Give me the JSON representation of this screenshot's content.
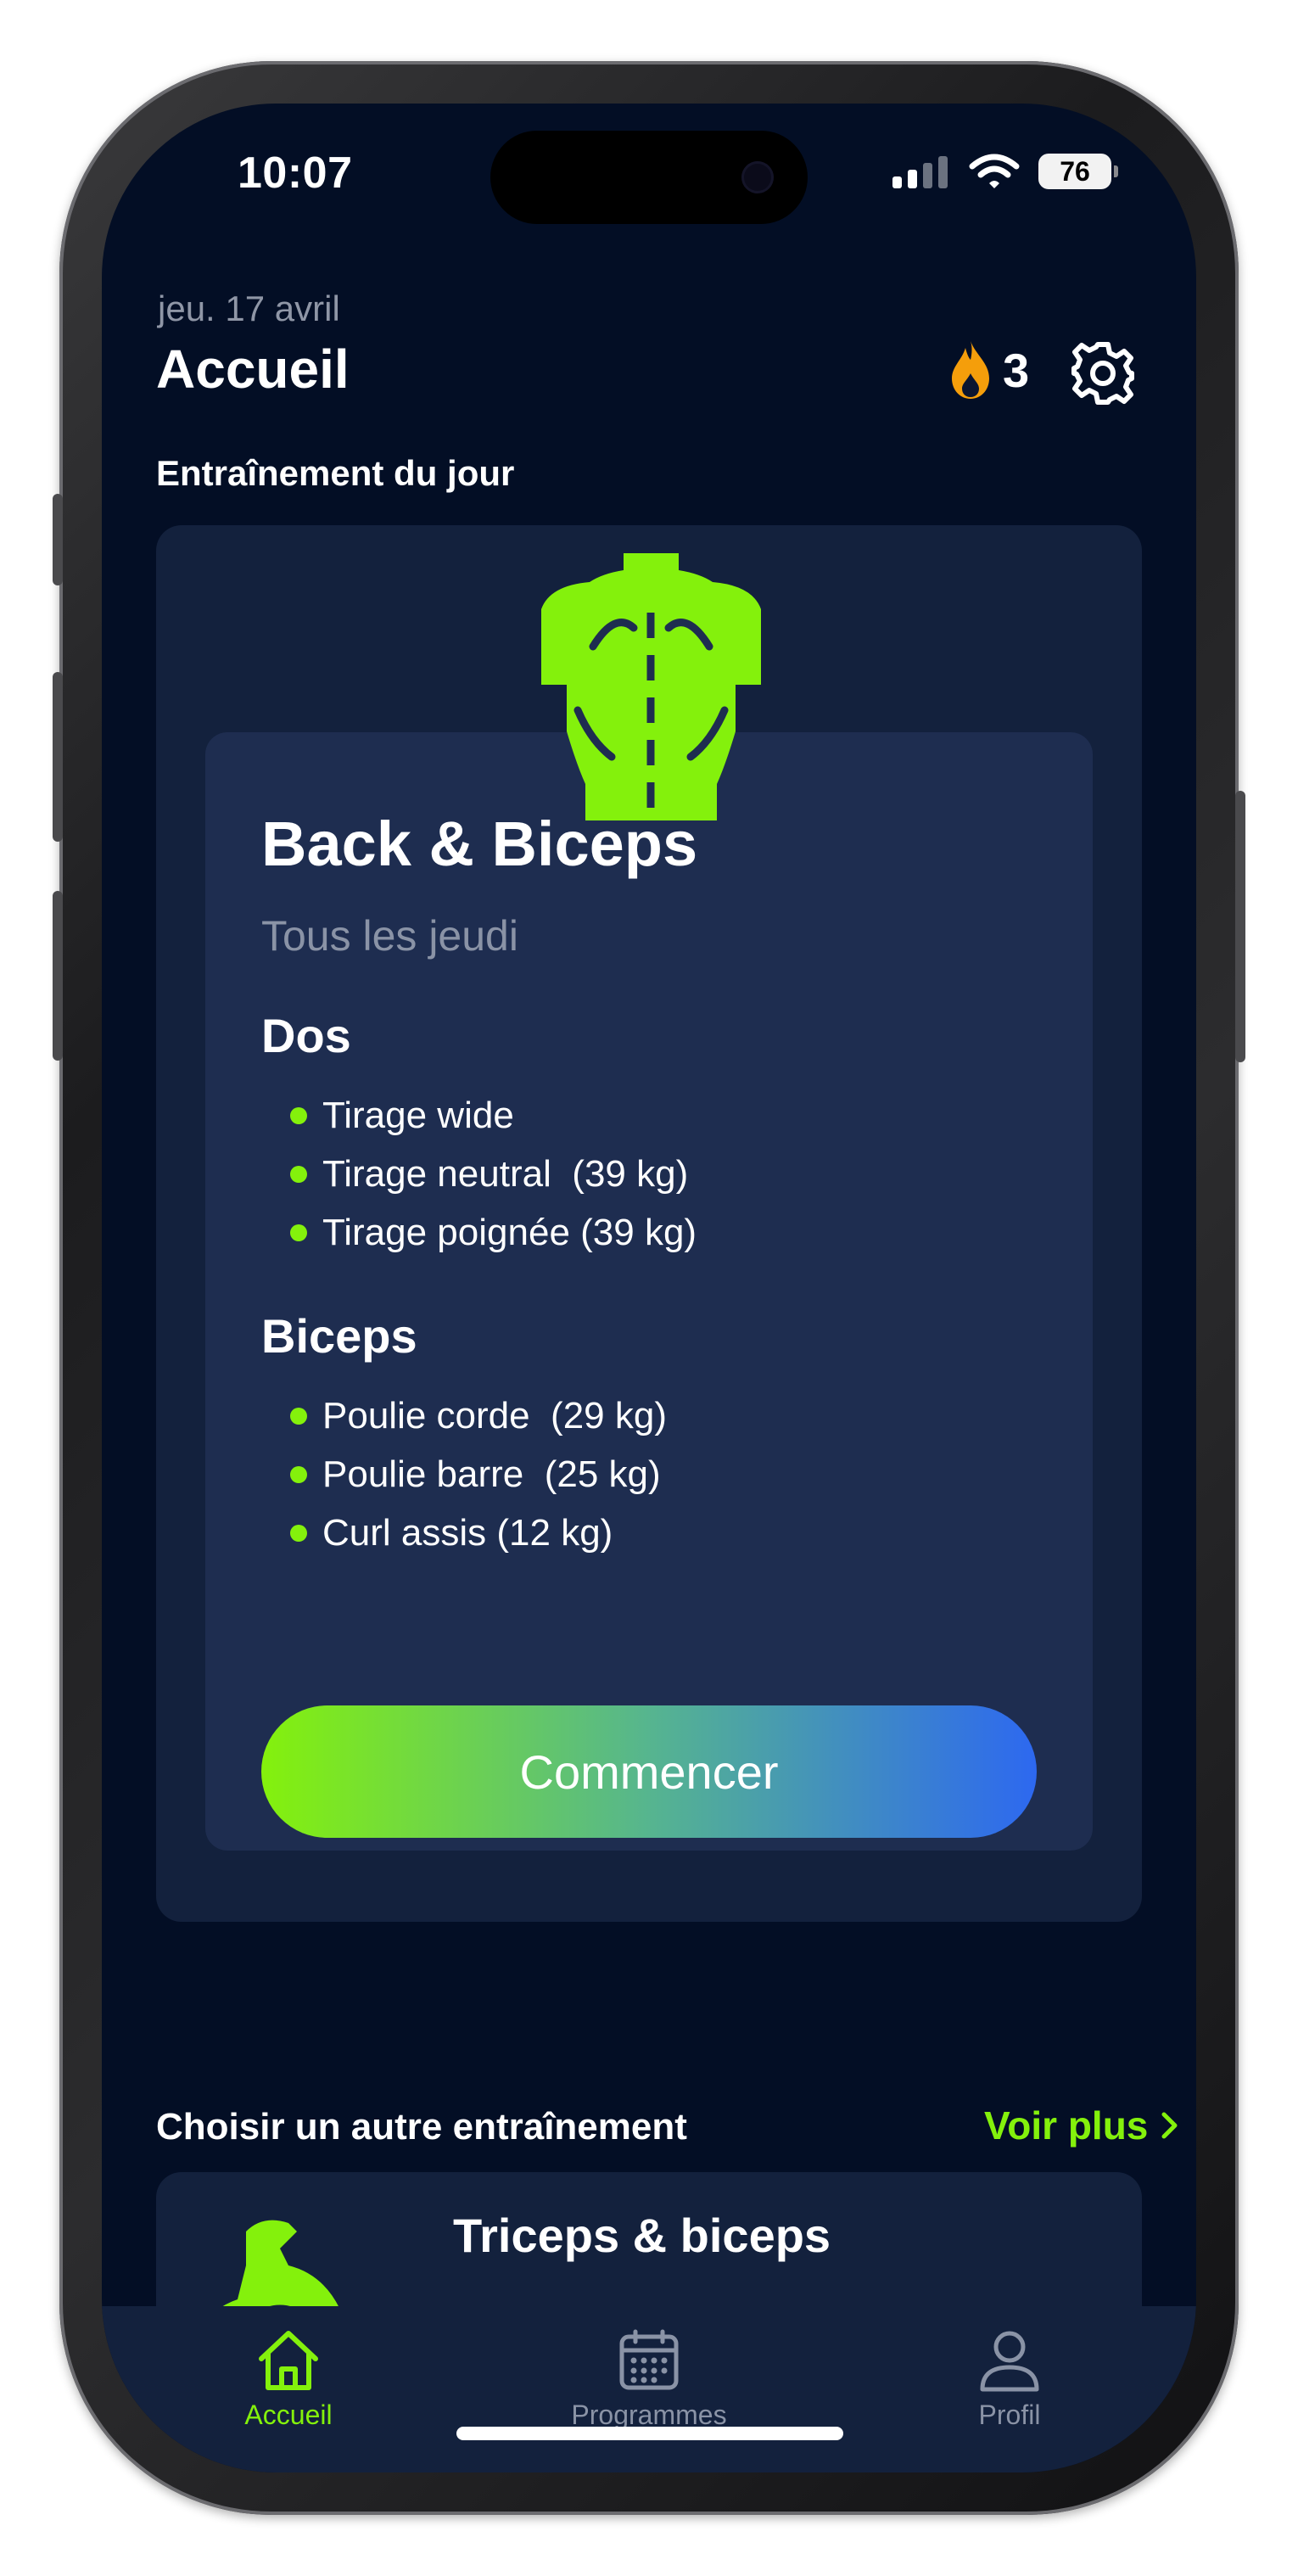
{
  "status_bar": {
    "time": "10:07",
    "battery": "76"
  },
  "header": {
    "date": "jeu. 17 avril",
    "title": "Accueil",
    "streak_count": "3"
  },
  "today": {
    "section_title": "Entraînement du jour",
    "workout_title": "Back & Biceps",
    "schedule": "Tous les jeudi",
    "groups": [
      {
        "name": "Dos",
        "exercises": [
          "Tirage wide",
          "Tirage neutral  (39 kg)",
          "Tirage poignée (39 kg)"
        ]
      },
      {
        "name": "Biceps",
        "exercises": [
          "Poulie corde  (29 kg)",
          "Poulie barre  (25 kg)",
          "Curl assis (12 kg)"
        ]
      }
    ],
    "start_label": "Commencer"
  },
  "other": {
    "section_title": "Choisir un autre entraînement",
    "see_more_label": "Voir plus",
    "next_workout_title": "Triceps & biceps"
  },
  "tabbar": {
    "items": [
      {
        "label": "Accueil",
        "icon": "house-icon",
        "active": true
      },
      {
        "label": "Programmes",
        "icon": "calendar-icon",
        "active": false
      },
      {
        "label": "Profil",
        "icon": "person-icon",
        "active": false
      }
    ]
  },
  "colors": {
    "background": "#030e25",
    "card": "#13213d",
    "inner_card": "#1e2d50",
    "accent": "#84f10c",
    "gradient_end": "#2d68f0",
    "muted_text": "#8a93a6"
  }
}
